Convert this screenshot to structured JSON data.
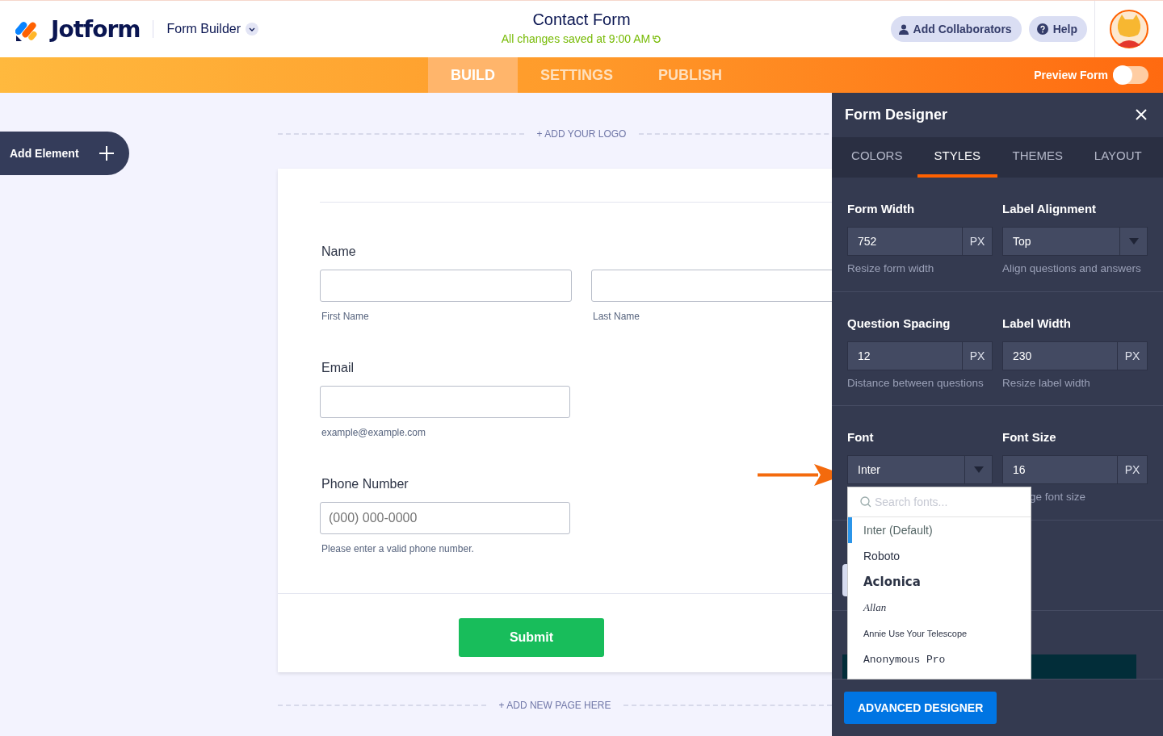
{
  "header": {
    "brand": "Jotform",
    "product": "Form Builder",
    "title": "Contact Form",
    "saved": "All changes saved at 9:00 AM",
    "buttons": [
      "Add Collaborators",
      "Help"
    ]
  },
  "nav": {
    "tabs": [
      {
        "label": "BUILD",
        "selected": true
      },
      {
        "label": "SETTINGS",
        "selected": false
      },
      {
        "label": "PUBLISH",
        "selected": false
      }
    ],
    "preview": {
      "label": "Preview Form",
      "on": false
    }
  },
  "canvas": {
    "add_element": "Add Element",
    "add_logo": "+ ADD YOUR LOGO",
    "add_page": "+ ADD NEW PAGE HERE",
    "submit": "Submit",
    "questions": [
      {
        "label": "Name",
        "fields": [
          {
            "sublabel": "First Name"
          },
          {
            "sublabel": "Last Name"
          }
        ]
      },
      {
        "label": "Email",
        "fields": [
          {
            "sublabel": "example@example.com"
          }
        ]
      },
      {
        "label": "Phone Number",
        "fields": [
          {
            "placeholder": "(000) 000-0000",
            "sublabel": "Please enter a valid phone number."
          }
        ]
      }
    ]
  },
  "designer": {
    "title": "Form Designer",
    "tabs": [
      {
        "label": "COLORS",
        "selected": false
      },
      {
        "label": "STYLES",
        "selected": true
      },
      {
        "label": "THEMES",
        "selected": false
      },
      {
        "label": "LAYOUT",
        "selected": false
      }
    ],
    "rows": [
      [
        {
          "label": "Form Width",
          "value": "752",
          "kind": "unit",
          "unit": "PX",
          "hint": "Resize form width"
        },
        {
          "label": "Label Alignment",
          "value": "Top",
          "kind": "select",
          "hint": "Align questions and answers"
        }
      ],
      [
        {
          "label": "Question Spacing",
          "value": "12",
          "kind": "unit",
          "unit": "PX",
          "hint": "Distance between questions"
        },
        {
          "label": "Label Width",
          "value": "230",
          "kind": "unit",
          "unit": "PX",
          "hint": "Resize label width"
        }
      ],
      [
        {
          "label": "Font",
          "value": "Inter",
          "kind": "select"
        },
        {
          "label": "Font Size",
          "value": "16",
          "kind": "unit",
          "unit": "PX",
          "hint": "ge font size"
        }
      ]
    ],
    "font_menu": {
      "placeholder": "Search fonts...",
      "items": [
        {
          "label": "Inter (Default)",
          "kind": "default",
          "selected": true
        },
        {
          "label": "Roboto",
          "kind": "sans",
          "selected": false
        },
        {
          "label": "Aclonica",
          "kind": "display",
          "selected": false
        },
        {
          "label": "Allan",
          "kind": "script",
          "selected": false
        },
        {
          "label": "Annie Use Your Telescope",
          "kind": "hand",
          "selected": false
        },
        {
          "label": "Anonymous Pro",
          "kind": "mono",
          "selected": false
        }
      ]
    },
    "advanced": "ADVANCED DESIGNER"
  }
}
